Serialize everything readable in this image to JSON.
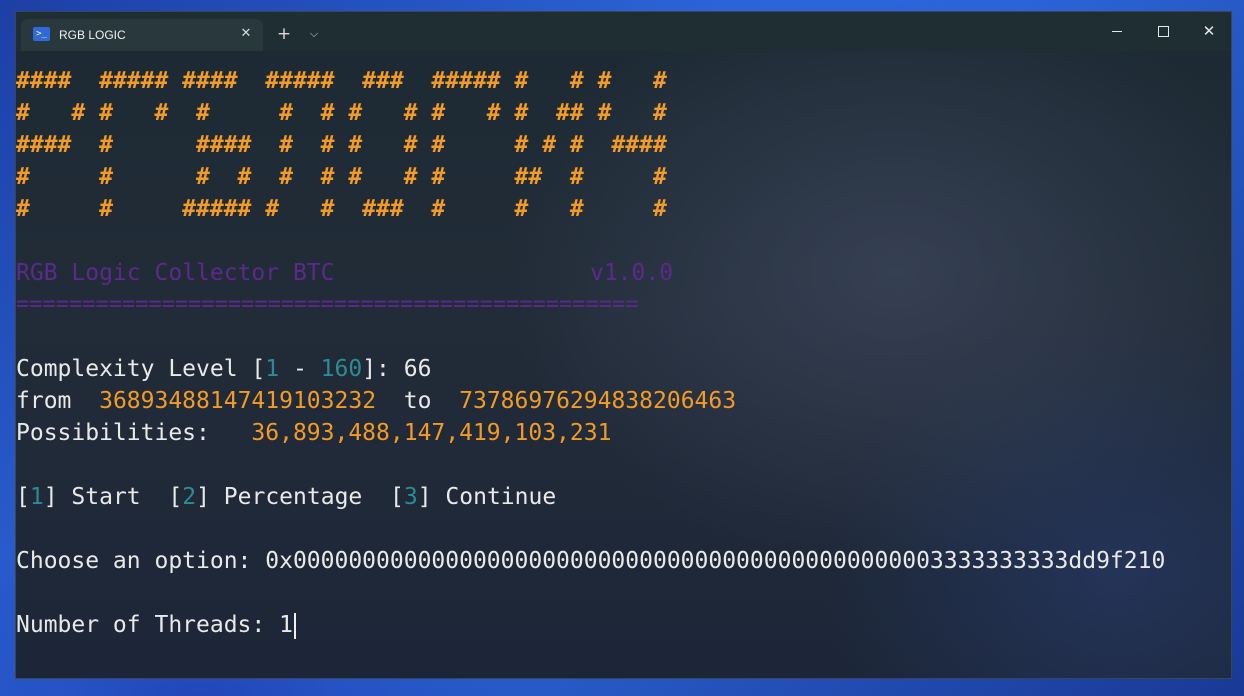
{
  "window": {
    "tab_title": "RGB LOGIC",
    "tab_icon": "powershell-icon",
    "new_tab_label": "+",
    "dropdown_label": "⌵",
    "close_tab_label": "✕",
    "close_window_label": "✕"
  },
  "banner": [
    "####  ##### ####  #####  ###  ##### #   # #   #",
    "#   # #   #  #     #  # #   # #   # #  ## #   #",
    "####  #      ####  #  # #   # #     # # #  ####",
    "#     #      #  #  #  # #   # #     ##  #     #",
    "#     #     ##### #   #  ###  #     #   #     #"
  ],
  "app": {
    "name": "RGB Logic Collector BTC",
    "version": "v1.0.0",
    "divider": "==============================================="
  },
  "complexity": {
    "label": "Complexity Level [",
    "min": "1",
    "sep": " - ",
    "max": "160",
    "close": "]: ",
    "value": "66"
  },
  "range": {
    "from_label": "from  ",
    "from_value": "36893488147419103232",
    "to_label": "  to  ",
    "to_value": "73786976294838206463"
  },
  "possibilities": {
    "label": "Possibilities:   ",
    "value": "36,893,488,147,419,103,231"
  },
  "menu": {
    "options": [
      {
        "key": "1",
        "label": "Start"
      },
      {
        "key": "2",
        "label": "Percentage"
      },
      {
        "key": "3",
        "label": "Continue"
      }
    ]
  },
  "prompt_option": {
    "label": "Choose an option: ",
    "value": "0x00000000000000000000000000000000000000000000003333333333dd9f210"
  },
  "prompt_threads": {
    "label": "Number of Threads: ",
    "value": "1"
  },
  "colors": {
    "banner": "#f39b25",
    "title": "#5b2a8c",
    "highlight": "#2a8c94",
    "number": "#f39b25",
    "text": "#e9e9e9"
  }
}
